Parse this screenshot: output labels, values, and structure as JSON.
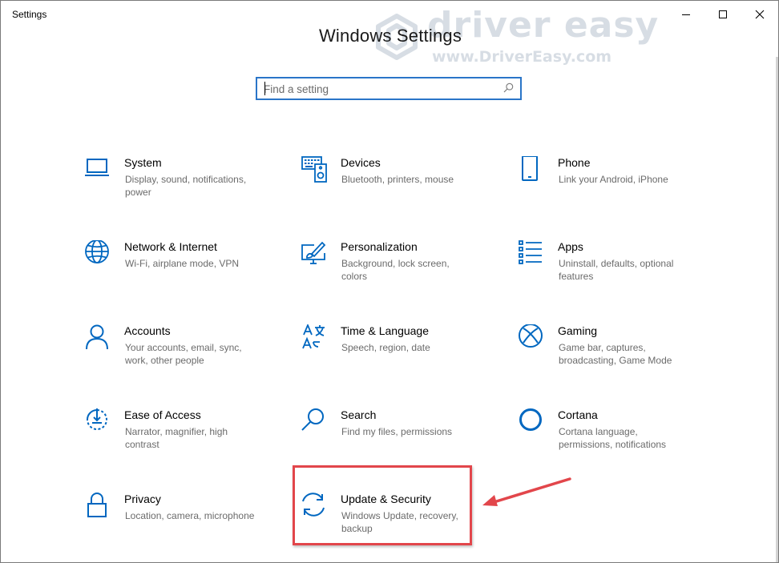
{
  "window": {
    "title": "Settings",
    "controls": [
      "minimize-icon",
      "maximize-icon",
      "close-icon"
    ]
  },
  "page": {
    "title": "Windows Settings"
  },
  "search": {
    "placeholder": "Find a setting",
    "value": "",
    "icon": "search-icon"
  },
  "watermark": {
    "brand": "driver easy",
    "url": "www.DriverEasy.com"
  },
  "tiles": [
    {
      "id": "system",
      "title": "System",
      "description": "Display, sound, notifications, power",
      "icon": "laptop-icon"
    },
    {
      "id": "devices",
      "title": "Devices",
      "description": "Bluetooth, printers, mouse",
      "icon": "keyboard-speaker-icon"
    },
    {
      "id": "phone",
      "title": "Phone",
      "description": "Link your Android, iPhone",
      "icon": "phone-icon"
    },
    {
      "id": "network",
      "title": "Network & Internet",
      "description": "Wi-Fi, airplane mode, VPN",
      "icon": "globe-icon"
    },
    {
      "id": "personalization",
      "title": "Personalization",
      "description": "Background, lock screen, colors",
      "icon": "paintbrush-monitor-icon"
    },
    {
      "id": "apps",
      "title": "Apps",
      "description": "Uninstall, defaults, optional features",
      "icon": "apps-list-icon"
    },
    {
      "id": "accounts",
      "title": "Accounts",
      "description": "Your accounts, email, sync, work, other people",
      "icon": "person-icon"
    },
    {
      "id": "time-language",
      "title": "Time & Language",
      "description": "Speech, region, date",
      "icon": "time-language-icon"
    },
    {
      "id": "gaming",
      "title": "Gaming",
      "description": "Game bar, captures, broadcasting, Game Mode",
      "icon": "xbox-icon"
    },
    {
      "id": "ease-of-access",
      "title": "Ease of Access",
      "description": "Narrator, magnifier, high contrast",
      "icon": "ease-of-access-icon"
    },
    {
      "id": "search",
      "title": "Search",
      "description": "Find my files, permissions",
      "icon": "magnifier-icon"
    },
    {
      "id": "cortana",
      "title": "Cortana",
      "description": "Cortana language, permissions, notifications",
      "icon": "cortana-ring-icon"
    },
    {
      "id": "privacy",
      "title": "Privacy",
      "description": "Location, camera, microphone",
      "icon": "lock-icon"
    },
    {
      "id": "update-security",
      "title": "Update & Security",
      "description": "Windows Update, recovery, backup",
      "icon": "sync-arrows-icon"
    }
  ],
  "annotation": {
    "highlight_color": "#e2464b",
    "target": "update-security"
  },
  "colors": {
    "accent": "#0067c0",
    "title_text": "#1a1a1a",
    "desc_text": "#6b6b6b",
    "search_border": "#2a75c8"
  }
}
